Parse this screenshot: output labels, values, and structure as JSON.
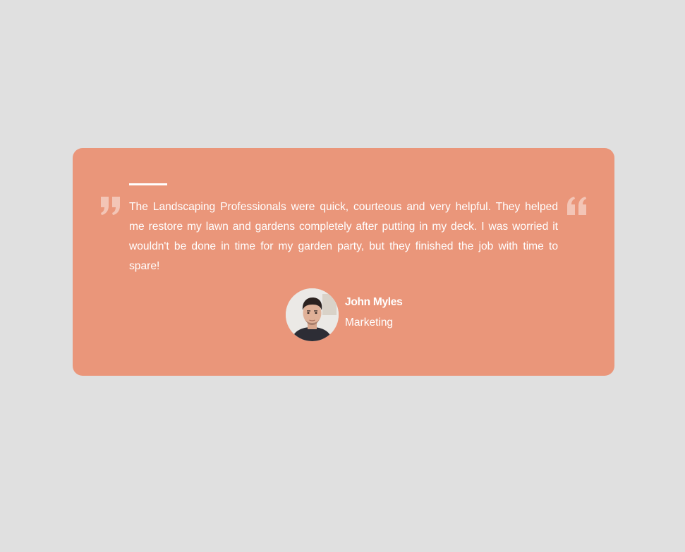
{
  "testimonial": {
    "quote": "The Landscaping Professionals were quick, courteous and very helpful. They helped me restore my lawn and gardens completely after putting in my deck. I was worried it wouldn't be done in time for my garden party, but they finished the job with time to spare!",
    "author_name": "John Myles",
    "author_role": "Marketing"
  },
  "icons": {
    "left_quote": "quote-close-icon",
    "right_quote": "quote-open-icon"
  },
  "colors": {
    "background": "#e0e0e0",
    "card": "#ea967a",
    "text": "#ffffff"
  }
}
